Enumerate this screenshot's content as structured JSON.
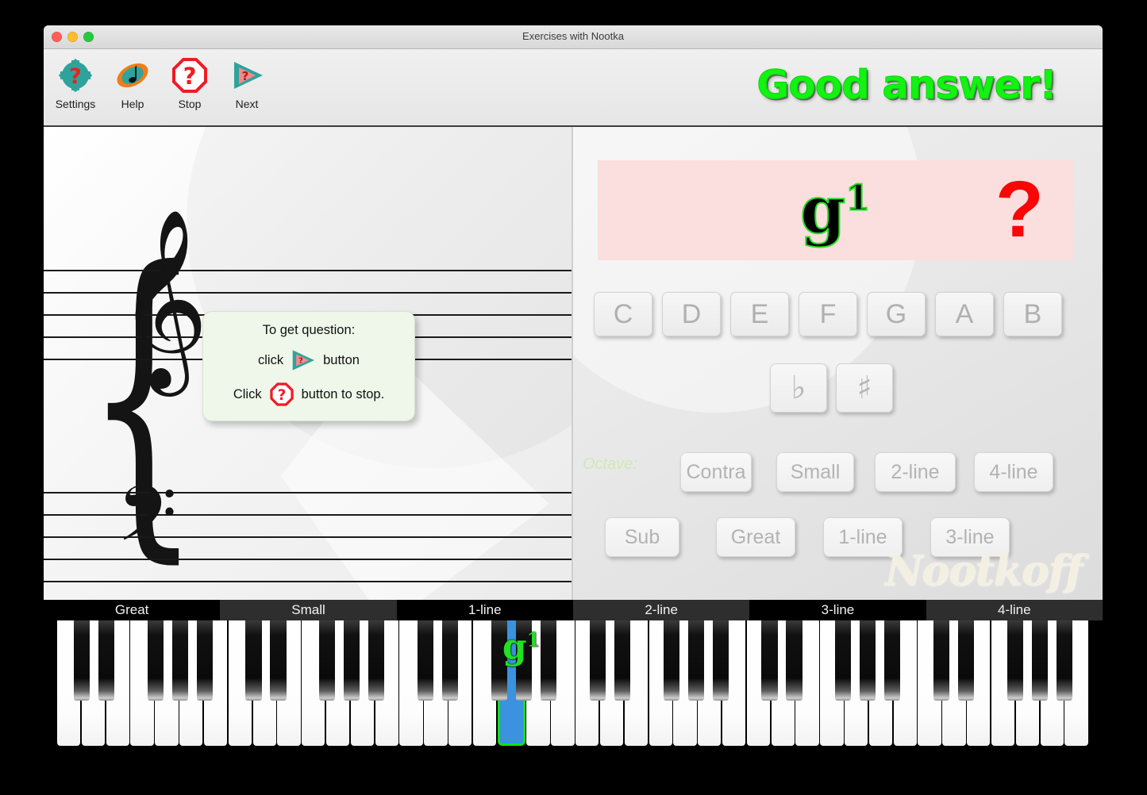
{
  "window": {
    "title": "Exercises with Nootka",
    "traffic_lights": [
      "close",
      "minimize",
      "zoom"
    ]
  },
  "toolbar": {
    "items": [
      {
        "label": "Settings",
        "icon": "gear-question-icon"
      },
      {
        "label": "Help",
        "icon": "nootka-note-icon"
      },
      {
        "label": "Stop",
        "icon": "stop-octagon-question-icon"
      },
      {
        "label": "Next",
        "icon": "next-triangle-question-icon"
      }
    ],
    "status_message": "Good answer!",
    "status_color": "#12f312"
  },
  "score": {
    "brace": "{",
    "treble_clef": "𝄞",
    "bass_clef": "𝄢",
    "tip": {
      "line1": "To get question:",
      "line2_before": "click",
      "line2_after": "button",
      "line3_before": "Click",
      "line3_after": "button to stop.",
      "next_icon": "next-triangle-question-icon",
      "stop_icon": "stop-octagon-question-icon"
    }
  },
  "exam": {
    "question": {
      "note_letter": "g",
      "note_octave": "1",
      "question_mark": "?",
      "background_color": "#fbdede",
      "note_outline_color": "#22e022",
      "question_mark_color": "#f90707"
    },
    "note_buttons": [
      "C",
      "D",
      "E",
      "F",
      "G",
      "A",
      "B"
    ],
    "accidental_buttons": [
      {
        "name": "flat",
        "glyph": "♭"
      },
      {
        "name": "sharp",
        "glyph": "♯"
      }
    ],
    "octave_watermark": "Octave:",
    "octave_buttons_top": [
      "Contra",
      "Small",
      "2-line",
      "4-line"
    ],
    "octave_buttons_bottom": [
      "Sub",
      "Great",
      "1-line",
      "3-line"
    ],
    "watermark": "Nootkoff"
  },
  "piano": {
    "octave_labels": [
      "Great",
      "Small",
      "1-line",
      "2-line",
      "3-line",
      "4-line"
    ],
    "white_keys_per_octave": 7,
    "total_white_keys": 42,
    "highlighted_key": {
      "index": 18,
      "label_letter": "g",
      "label_octave": "1",
      "fill_color": "#3a92e0",
      "outline_color": "#15e015"
    }
  }
}
